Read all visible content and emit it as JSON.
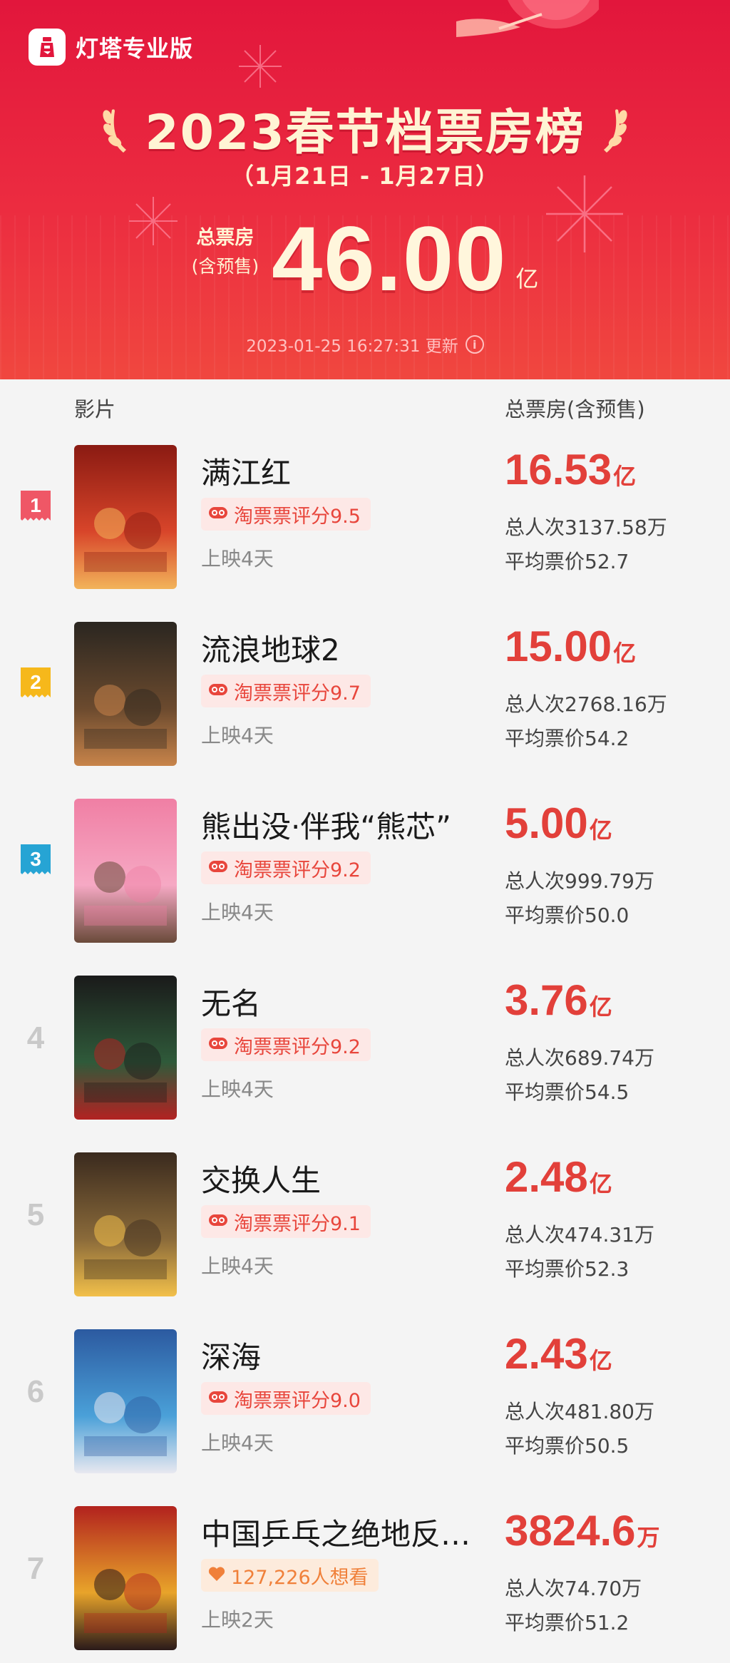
{
  "brand": {
    "name": "灯塔专业版",
    "logo_icon": "lighthouse-logo-icon"
  },
  "header": {
    "title": "2023春节档票房榜",
    "date_range": "（1月21日 - 1月27日）",
    "total_label_1": "总票房",
    "total_label_2": "(含预售)",
    "total_value": "46.00",
    "total_unit": "亿",
    "update_text": "2023-01-25 16:27:31 更新",
    "info_icon_glyph": "i"
  },
  "table": {
    "col_film": "影片",
    "col_box": "总票房(含预售)"
  },
  "colors": {
    "banner_top": "#e2163c",
    "accent_red": "#e2403a",
    "rank1": "#ef5766",
    "rank2": "#f6b81b",
    "rank3": "#26a4d4",
    "rating_bg": "#fde8e6"
  },
  "films": [
    {
      "rank": "1",
      "title": "满江红",
      "badge": "淘票票评分9.5",
      "badge_icon": "taopiao-eye-icon",
      "days": "上映4天",
      "box": "16.53",
      "box_unit": "亿",
      "viewers": "总人次3137.58万",
      "avg_price": "平均票价52.7"
    },
    {
      "rank": "2",
      "title": "流浪地球2",
      "badge": "淘票票评分9.7",
      "badge_icon": "taopiao-eye-icon",
      "days": "上映4天",
      "box": "15.00",
      "box_unit": "亿",
      "viewers": "总人次2768.16万",
      "avg_price": "平均票价54.2"
    },
    {
      "rank": "3",
      "title": "熊出没·伴我“熊芯”",
      "badge": "淘票票评分9.2",
      "badge_icon": "taopiao-eye-icon",
      "days": "上映4天",
      "box": "5.00",
      "box_unit": "亿",
      "viewers": "总人次999.79万",
      "avg_price": "平均票价50.0"
    },
    {
      "rank": "4",
      "title": "无名",
      "badge": "淘票票评分9.2",
      "badge_icon": "taopiao-eye-icon",
      "days": "上映4天",
      "box": "3.76",
      "box_unit": "亿",
      "viewers": "总人次689.74万",
      "avg_price": "平均票价54.5"
    },
    {
      "rank": "5",
      "title": "交换人生",
      "badge": "淘票票评分9.1",
      "badge_icon": "taopiao-eye-icon",
      "days": "上映4天",
      "box": "2.48",
      "box_unit": "亿",
      "viewers": "总人次474.31万",
      "avg_price": "平均票价52.3"
    },
    {
      "rank": "6",
      "title": "深海",
      "badge": "淘票票评分9.0",
      "badge_icon": "taopiao-eye-icon",
      "days": "上映4天",
      "box": "2.43",
      "box_unit": "亿",
      "viewers": "总人次481.80万",
      "avg_price": "平均票价50.5"
    },
    {
      "rank": "7",
      "title": "中国乒乓之绝地反…",
      "badge": "127,226人想看",
      "badge_icon": "heart-icon",
      "days": "上映2天",
      "box": "3824.6",
      "box_unit": "万",
      "viewers": "总人次74.70万",
      "avg_price": "平均票价51.2"
    }
  ]
}
